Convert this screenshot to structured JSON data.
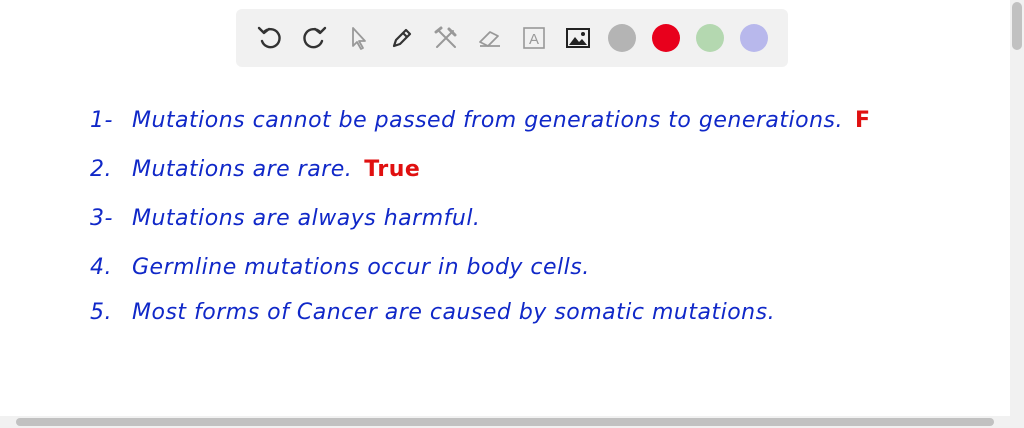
{
  "toolbar": {
    "tools": [
      {
        "name": "undo-icon"
      },
      {
        "name": "redo-icon"
      },
      {
        "name": "pointer-icon"
      },
      {
        "name": "pen-icon"
      },
      {
        "name": "tools-icon"
      },
      {
        "name": "eraser-icon"
      },
      {
        "name": "text-icon"
      },
      {
        "name": "image-icon"
      }
    ],
    "text_tool_glyph": "A",
    "colors": [
      "#b4b4b4",
      "#e8001c",
      "#b4d8b0",
      "#b8b8ec"
    ]
  },
  "notes": {
    "lines": [
      {
        "number": "1-",
        "text": "Mutations cannot be passed from generations to generations.",
        "answer": "F"
      },
      {
        "number": "2.",
        "text": "Mutations are rare.",
        "answer": "True"
      },
      {
        "number": "3-",
        "text": "Mutations are always harmful.",
        "answer": ""
      },
      {
        "number": "4.",
        "text": "Germline mutations occur in body cells.",
        "answer": ""
      },
      {
        "number": "5.",
        "text": "Most forms of Cancer are caused by somatic mutations.",
        "answer": ""
      }
    ]
  }
}
